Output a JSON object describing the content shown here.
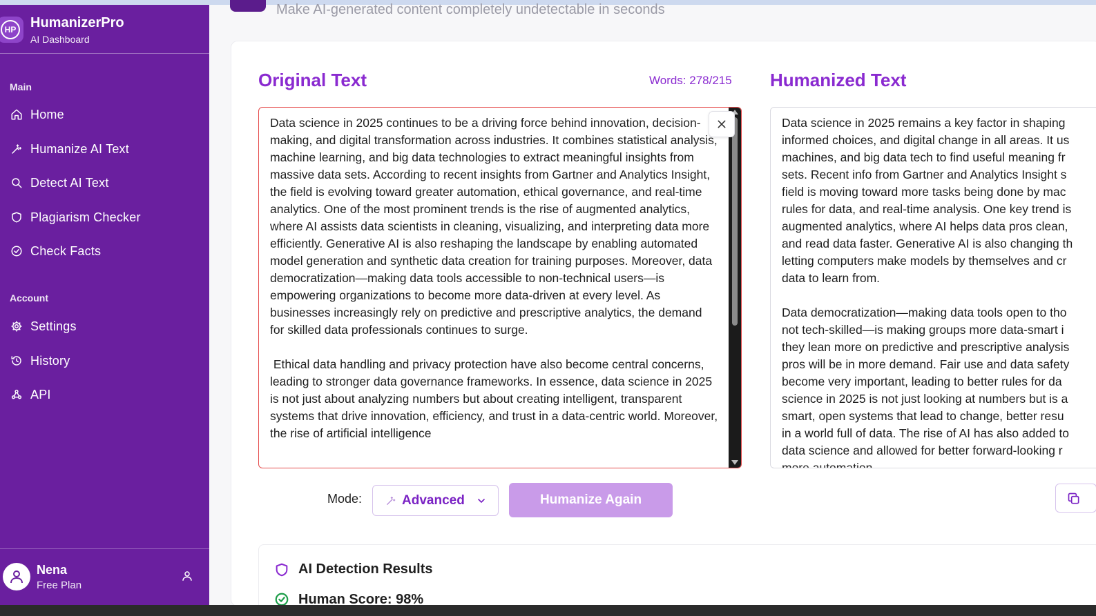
{
  "brand": {
    "initials": "HP",
    "name": "HumanizerPro",
    "subtitle": "AI Dashboard"
  },
  "sidebar": {
    "main_label": "Main",
    "main_items": [
      {
        "label": "Home",
        "icon": "home-icon"
      },
      {
        "label": "Humanize AI Text",
        "icon": "wand-icon"
      },
      {
        "label": "Detect AI Text",
        "icon": "search-icon"
      },
      {
        "label": "Plagiarism Checker",
        "icon": "shield-icon"
      },
      {
        "label": "Check Facts",
        "icon": "check-circle-icon"
      }
    ],
    "account_label": "Account",
    "account_items": [
      {
        "label": "Settings",
        "icon": "gear-icon"
      },
      {
        "label": "History",
        "icon": "history-icon"
      },
      {
        "label": "API",
        "icon": "webhook-icon"
      }
    ]
  },
  "user": {
    "name": "Nena",
    "plan": "Free Plan"
  },
  "header": {
    "subtitle": "Make AI-generated content completely undetectable in seconds"
  },
  "original": {
    "title": "Original Text",
    "words": "Words: 278/215",
    "text": "Data science in 2025 continues to be a driving force behind innovation, decision-making, and digital transformation across industries. It combines statistical analysis, machine learning, and big data technologies to extract meaningful insights from massive data sets. According to recent insights from Gartner and Analytics Insight, the field is evolving toward greater automation, ethical governance, and real-time analytics. One of the most prominent trends is the rise of augmented analytics, where AI assists data scientists in cleaning, visualizing, and interpreting data more efficiently. Generative AI is also reshaping the landscape by enabling automated model generation and synthetic data creation for training purposes. Moreover, data democratization—making data tools accessible to non-technical users—is empowering organizations to become more data-driven at every level. As businesses increasingly rely on predictive and prescriptive analytics, the demand for skilled data professionals continues to surge.\n\n Ethical data handling and privacy protection have also become central concerns, leading to stronger data governance frameworks. In essence, data science in 2025 is not just about analyzing numbers but about creating intelligent, transparent systems that drive innovation, efficiency, and trust in a data-centric world. Moreover, the rise of artificial intelligence"
  },
  "humanized": {
    "title": "Humanized Text",
    "text": "Data science in 2025 remains a key factor in shaping\ninformed choices, and digital change in all areas. It us\nmachines, and big data tech to find useful meaning fr\nsets. Recent info from Gartner and Analytics Insight s\nfield is moving toward more tasks being done by mac\nrules for data, and real-time analysis. One key trend is\naugmented analytics, where AI helps data pros clean,\nand read data faster. Generative AI is also changing th\nletting computers make models by themselves and cr\ndata to learn from.\n\nData democratization—making data tools open to tho\nnot tech-skilled—is making groups more data-smart i\nthey lean more on predictive and prescriptive analysis\npros will be in more demand. Fair use and data safety\nbecome very important, leading to better rules for da\nscience in 2025 is not just looking at numbers but is a\nsmart, open systems that lead to change, better resu\nin a world full of data. The rise of AI has also added to\ndata science and allowed for better forward-looking r\nmore automation."
  },
  "controls": {
    "mode_label": "Mode:",
    "mode_value": "Advanced",
    "humanize_label": "Humanize Again"
  },
  "results": {
    "title": "AI Detection Results",
    "score": "Human Score: 98%"
  },
  "colors": {
    "sidebar": "#6a1f9f",
    "accent": "#8a2ad0",
    "button": "#c99be9",
    "error_border": "#e54b4b",
    "success": "#1e9e4a"
  }
}
